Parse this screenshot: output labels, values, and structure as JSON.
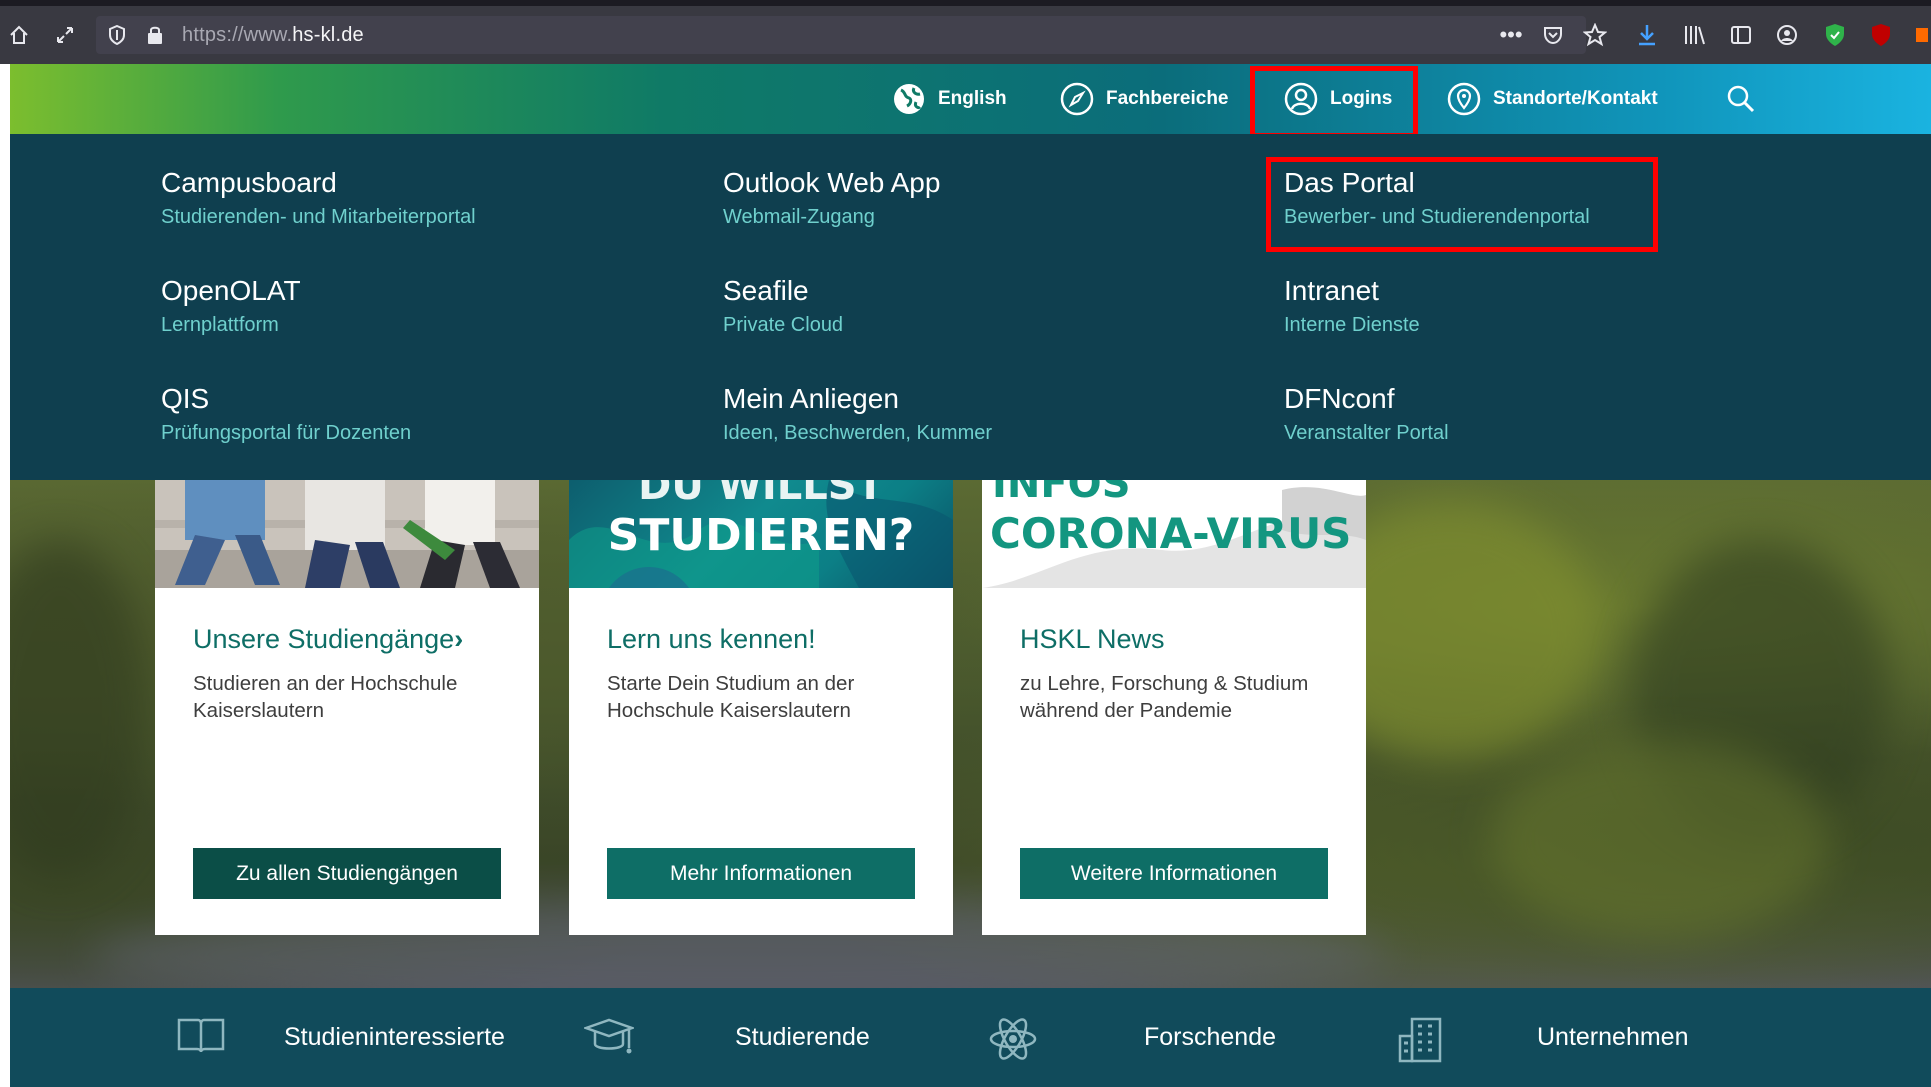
{
  "browser": {
    "url_prefix": "https://www.",
    "url_domain": "hs-kl.de"
  },
  "top_nav": {
    "items": [
      {
        "label": "English",
        "icon": "globe-icon"
      },
      {
        "label": "Fachbereiche",
        "icon": "compass-icon"
      },
      {
        "label": "Logins",
        "icon": "user-circle-icon"
      },
      {
        "label": "Standorte/Kontakt",
        "icon": "location-pin-icon"
      }
    ]
  },
  "logins": [
    {
      "title": "Campusboard",
      "subtitle": "Studierenden- und Mitarbeiterportal"
    },
    {
      "title": "Outlook Web App",
      "subtitle": "Webmail-Zugang"
    },
    {
      "title": "Das Portal",
      "subtitle": "Bewerber- und Studierendenportal"
    },
    {
      "title": "OpenOLAT",
      "subtitle": "Lernplattform"
    },
    {
      "title": "Seafile",
      "subtitle": "Private Cloud"
    },
    {
      "title": "Intranet",
      "subtitle": "Interne Dienste"
    },
    {
      "title": "QIS",
      "subtitle": "Prüfungsportal für Dozenten"
    },
    {
      "title": "Mein Anliegen",
      "subtitle": "Ideen, Beschwerden, Kummer"
    },
    {
      "title": "DFNconf",
      "subtitle": "Veranstalter Portal"
    }
  ],
  "cards": [
    {
      "title": "Unsere Studiengänge",
      "text": "Studieren an der Hochschule Kaiserslautern",
      "button": "Zu allen Studiengängen"
    },
    {
      "image_text_1": "DU WILLST",
      "image_text_2": "STUDIEREN?",
      "title": "Lern uns kennen!",
      "text": "Starte Dein Studium an der Hochschule Kaiserslautern",
      "button": "Mehr Informationen"
    },
    {
      "image_text_1": "INFOS",
      "image_text_2": "CORONA-VIRUS",
      "title": "HSKL News",
      "text": "zu Lehre, Forschung & Studium während der Pandemie",
      "button": "Weitere Informationen"
    }
  ],
  "bottom_nav": [
    {
      "label": "Studieninteressierte",
      "icon": "book-icon"
    },
    {
      "label": "Studierende",
      "icon": "graduation-cap-icon"
    },
    {
      "label": "Forschende",
      "icon": "atom-icon"
    },
    {
      "label": "Unternehmen",
      "icon": "building-icon"
    }
  ],
  "colors": {
    "dropdown_bg": "#0f3f4f",
    "subtitle": "#6fd0cd",
    "accent": "#0e6e66",
    "highlight": "#ff0000"
  }
}
